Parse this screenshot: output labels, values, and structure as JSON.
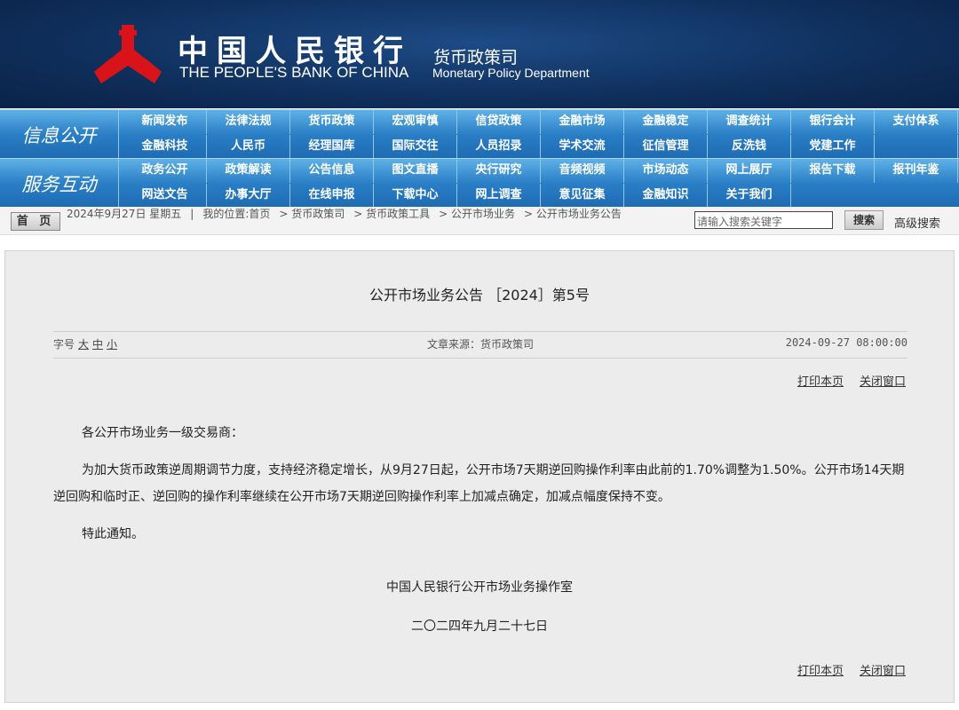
{
  "header": {
    "cn_title": "中国人民银行",
    "en_title": "THE PEOPLE'S BANK OF CHINA",
    "dept_cn": "货币政策司",
    "dept_en": "Monetary Policy Department",
    "logo_color": "#d8141a"
  },
  "nav": {
    "band1": {
      "label": "信息公开",
      "row1": [
        "新闻发布",
        "法律法规",
        "货币政策",
        "宏观审慎",
        "信贷政策",
        "金融市场",
        "金融稳定",
        "调查统计",
        "银行会计",
        "支付体系"
      ],
      "row2": [
        "金融科技",
        "人民币",
        "经理国库",
        "国际交往",
        "人员招录",
        "学术交流",
        "征信管理",
        "反洗钱",
        "党建工作",
        ""
      ]
    },
    "band2": {
      "label": "服务互动",
      "row1": [
        "政务公开",
        "政策解读",
        "公告信息",
        "图文直播",
        "央行研究",
        "音频视频",
        "市场动态",
        "网上展厅",
        "报告下载",
        "报刊年鉴"
      ],
      "row2": [
        "网送文告",
        "办事大厅",
        "在线申报",
        "下载中心",
        "网上调查",
        "意见征集",
        "金融知识",
        "关于我们"
      ]
    }
  },
  "crumbbar": {
    "home": "首 页",
    "date": "2024年9月27日 星期五",
    "sep": "|",
    "location_label": "我的位置:首页",
    "crumbs": [
      "货币政策司",
      "货币政策工具",
      "公开市场业务",
      "公开市场业务公告"
    ],
    "search_placeholder": "请输入搜索关键字",
    "search_button": "搜索",
    "advanced": "高级搜索"
  },
  "article": {
    "title": "公开市场业务公告 ［2024］第5号",
    "font_size_label": "字号",
    "font_sizes": [
      "大",
      "中",
      "小"
    ],
    "source": "文章来源：货币政策司",
    "datetime": "2024-09-27 08:00:00",
    "print": "打印本页",
    "close": "关闭窗口",
    "greeting": "各公开市场业务一级交易商：",
    "paragraph": "为加大货币政策逆周期调节力度，支持经济稳定增长，从9月27日起，公开市场7天期逆回购操作利率由此前的1.70%调整为1.50%。公开市场14天期逆回购和临时正、逆回购的操作利率继续在公开市场7天期逆回购操作利率上加减点确定，加减点幅度保持不变。",
    "closing": "特此通知。",
    "signer": "中国人民银行公开市场业务操作室",
    "sign_date": "二〇二四年九月二十七日"
  }
}
